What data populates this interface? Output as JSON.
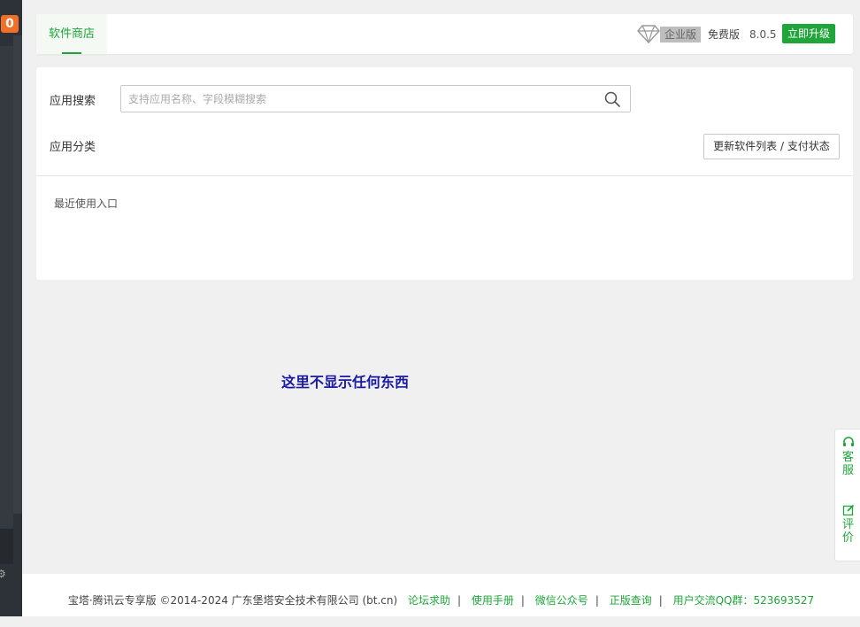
{
  "sidebar": {
    "badge": "0"
  },
  "header": {
    "tab_label": "软件商店",
    "edition_badge": "企业版",
    "free_label": "免费版",
    "version": "8.0.5",
    "upgrade_label": "立即升级"
  },
  "search": {
    "label": "应用搜索",
    "placeholder": "支持应用名称、字段模糊搜索"
  },
  "category": {
    "label": "应用分类",
    "refresh_label": "更新软件列表 / 支付状态"
  },
  "recent": {
    "label": "最近使用入口"
  },
  "empty_message": "这里不显示任何东西",
  "float_panel": {
    "service_label": "客服",
    "review_label": "评价"
  },
  "footer": {
    "copyright": "宝塔·腾讯云专享版 ©2014-2024 广东堡塔安全技术有限公司 (bt.cn)",
    "links": [
      "论坛求助",
      "使用手册",
      "微信公众号",
      "正版查询",
      "用户交流QQ群：523693527"
    ]
  },
  "colors": {
    "accent": "#20a53a",
    "badge": "#f07029",
    "sidebar": "#2d3238"
  }
}
